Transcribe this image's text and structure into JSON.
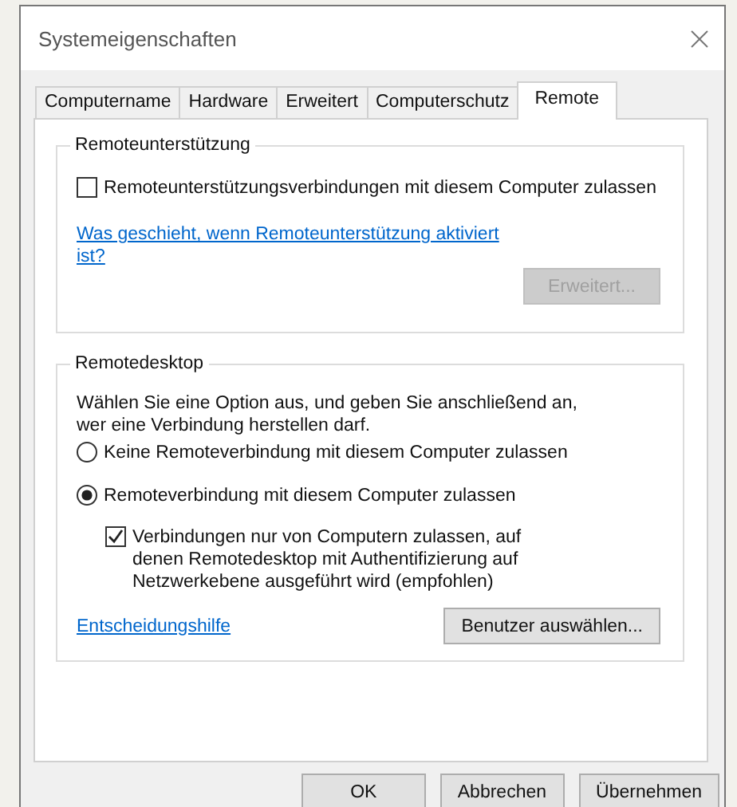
{
  "window": {
    "title": "Systemeigenschaften"
  },
  "tabs": [
    {
      "label": "Computername",
      "selected": false
    },
    {
      "label": "Hardware",
      "selected": false
    },
    {
      "label": "Erweitert",
      "selected": false
    },
    {
      "label": "Computerschutz",
      "selected": false
    },
    {
      "label": "Remote",
      "selected": true
    }
  ],
  "remote_assistance": {
    "title": "Remoteunterstützung",
    "checkbox": {
      "label": "Remoteunterstützungsverbindungen mit diesem Computer zulassen",
      "checked": false
    },
    "link": "Was geschieht, wenn Remoteunterstützung aktiviert ist?",
    "button": {
      "label": "Erweitert...",
      "disabled": true
    }
  },
  "remote_desktop": {
    "title": "Remotedesktop",
    "description": "Wählen Sie eine Option aus, und geben Sie anschließend an, wer eine Verbindung herstellen darf.",
    "options": [
      {
        "label": "Keine Remoteverbindung mit diesem Computer zulassen",
        "selected": false
      },
      {
        "label": "Remoteverbindung mit diesem Computer zulassen",
        "selected": true
      }
    ],
    "sub_checkbox": {
      "label": "Verbindungen nur von Computern zulassen, auf denen Remotedesktop mit Authentifizierung auf Netzwerkebene ausgeführt wird (empfohlen)",
      "checked": true
    },
    "link": "Entscheidungshilfe",
    "button": {
      "label": "Benutzer auswählen...",
      "disabled": false
    }
  },
  "buttons": [
    {
      "label": "OK"
    },
    {
      "label": "Abbrechen"
    },
    {
      "label": "Übernehmen"
    }
  ]
}
